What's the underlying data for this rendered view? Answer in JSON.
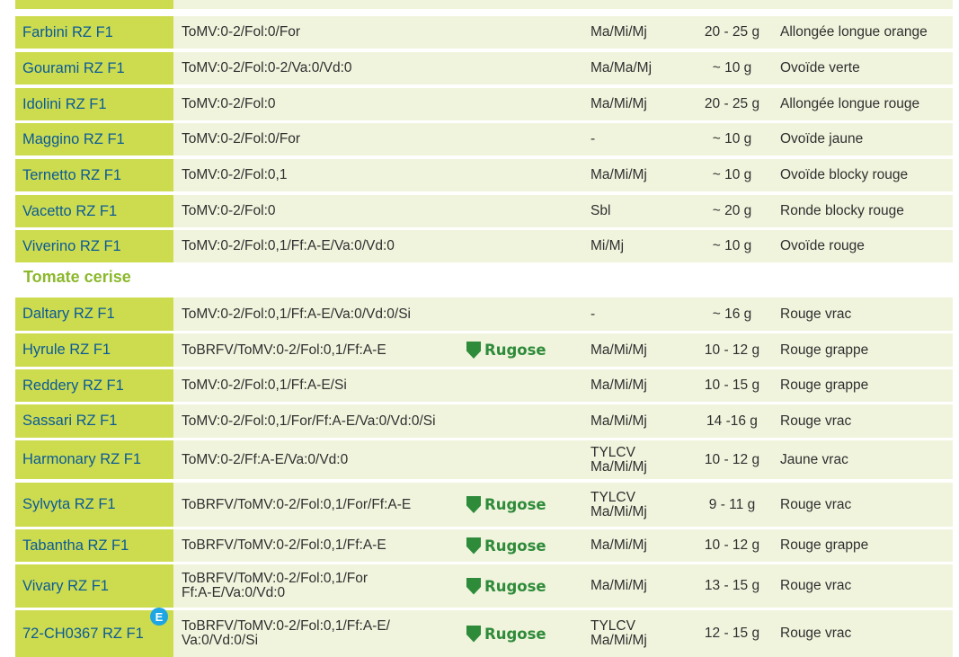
{
  "section1": {
    "rows": [
      {
        "name": "Farbini RZ F1",
        "code": "ToMV:0-2/Fol:0/For",
        "badge": "",
        "res": "Ma/Mi/Mj",
        "weight": "20 - 25 g",
        "fruit": "Allongée longue orange"
      },
      {
        "name": "Gourami RZ F1",
        "code": "ToMV:0-2/Fol:0-2/Va:0/Vd:0",
        "badge": "",
        "res": "Ma/Ma/Mj",
        "weight": "~ 10 g",
        "fruit": "Ovoïde verte"
      },
      {
        "name": "Idolini RZ F1",
        "code": "ToMV:0-2/Fol:0",
        "badge": "",
        "res": "Ma/Mi/Mj",
        "weight": "20 - 25 g",
        "fruit": "Allongée longue rouge"
      },
      {
        "name": "Maggino RZ F1",
        "code": "ToMV:0-2/Fol:0/For",
        "badge": "",
        "res": "-",
        "weight": "~ 10 g",
        "fruit": "Ovoïde jaune"
      },
      {
        "name": "Ternetto RZ F1",
        "code": "ToMV:0-2/Fol:0,1",
        "badge": "",
        "res": "Ma/Mi/Mj",
        "weight": "~ 10 g",
        "fruit": "Ovoïde blocky rouge"
      },
      {
        "name": "Vacetto RZ F1",
        "code": "ToMV:0-2/Fol:0",
        "badge": "",
        "res": "Sbl",
        "weight": "~ 20 g",
        "fruit": "Ronde blocky rouge"
      },
      {
        "name": "Viverino RZ F1",
        "code": "ToMV:0-2/Fol:0,1/Ff:A-E/Va:0/Vd:0",
        "badge": "",
        "res": "Mi/Mj",
        "weight": "~ 10 g",
        "fruit": "Ovoïde rouge"
      }
    ]
  },
  "section2": {
    "title": "Tomate cerise",
    "rows": [
      {
        "name": "Daltary RZ F1",
        "code": "ToMV:0-2/Fol:0,1/Ff:A-E/Va:0/Vd:0/Si",
        "badge": "",
        "res": "-",
        "weight": "~ 16 g",
        "fruit": "Rouge vrac"
      },
      {
        "name": "Hyrule RZ F1",
        "code": "ToBRFV/ToMV:0-2/Fol:0,1/Ff:A-E",
        "badge": "Rugose",
        "res": "Ma/Mi/Mj",
        "weight": "10 - 12 g",
        "fruit": "Rouge grappe"
      },
      {
        "name": "Reddery RZ F1",
        "code": "ToMV:0-2/Fol:0,1/Ff:A-E/Si",
        "badge": "",
        "res": "Ma/Mi/Mj",
        "weight": "10 - 15 g",
        "fruit": "Rouge grappe"
      },
      {
        "name": "Sassari RZ F1",
        "code": "ToMV:0-2/Fol:0,1/For/Ff:A-E/Va:0/Vd:0/Si",
        "badge": "",
        "res": "Ma/Mi/Mj",
        "weight": "14 -16 g",
        "fruit": "Rouge vrac"
      },
      {
        "name": "Harmonary RZ F1",
        "code": "ToMV:0-2/Ff:A-E/Va:0/Vd:0",
        "badge": "",
        "res": "TYLCV\nMa/Mi/Mj",
        "weight": "10 - 12 g",
        "fruit": "Jaune vrac"
      },
      {
        "name": "Sylvyta RZ F1",
        "code": "ToBRFV/ToMV:0-2/Fol:0,1/For/Ff:A-E",
        "badge": "Rugose",
        "res": "TYLCV\nMa/Mi/Mj",
        "weight": "9 - 11 g",
        "fruit": "Rouge vrac"
      },
      {
        "name": "Tabantha RZ F1",
        "code": "ToBRFV/ToMV:0-2/Fol:0,1/Ff:A-E",
        "badge": "Rugose",
        "res": "Ma/Mi/Mj",
        "weight": "10 - 12 g",
        "fruit": "Rouge grappe"
      },
      {
        "name": "Vivary RZ F1",
        "code": "ToBRFV/ToMV:0-2/Fol:0,1/For\nFf:A-E/Va:0/Vd:0",
        "badge": "Rugose",
        "res": "Ma/Mi/Mj",
        "weight": "13 - 15 g",
        "fruit": "Rouge vrac"
      },
      {
        "name": "72-CH0367 RZ F1",
        "code": "ToBRFV/ToMV:0-2/Fol:0,1/Ff:A-E/\nVa:0/Vd:0/Si",
        "badge": "Rugose",
        "res": "TYLCV\nMa/Mi/Mj",
        "weight": "12 - 15 g",
        "fruit": "Rouge vrac"
      }
    ]
  },
  "e_marker": "E"
}
